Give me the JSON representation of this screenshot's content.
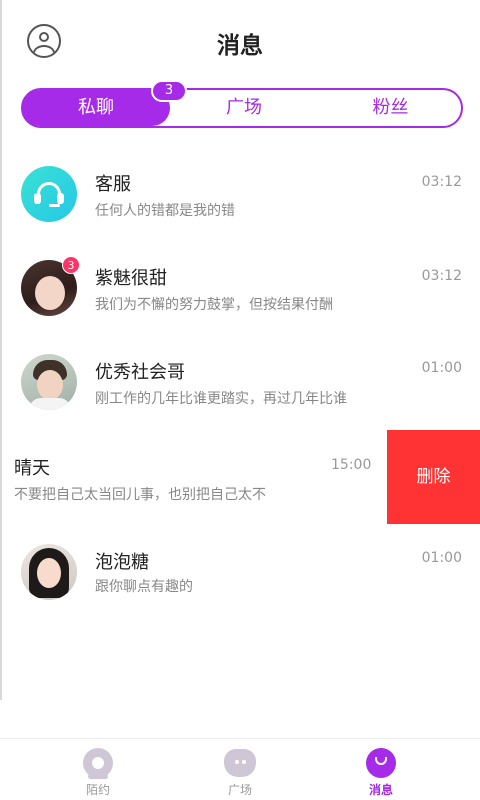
{
  "header": {
    "title": "消息",
    "profile_icon": "user-circle-icon"
  },
  "tabs": [
    {
      "label": "私聊",
      "active": true,
      "badge": "3"
    },
    {
      "label": "广场",
      "active": false
    },
    {
      "label": "粉丝",
      "active": false
    }
  ],
  "conversations": [
    {
      "name": "客服",
      "preview": "任何人的错都是我的错",
      "time": "03:12",
      "avatar": "headset-icon"
    },
    {
      "name": "紫魅很甜",
      "preview": "我们为不懈的努力鼓掌，但按结果付酬",
      "time": "03:12",
      "unread": "3",
      "avatar": "user-photo"
    },
    {
      "name": "优秀社会哥",
      "preview": "刚工作的几年比谁更踏实，再过几年比谁",
      "time": "01:00",
      "avatar": "user-photo"
    },
    {
      "name": "晴天",
      "preview": "不要把自己太当回儿事，也别把自己太不",
      "time": "15:00",
      "action": "删除"
    },
    {
      "name": "泡泡糖",
      "preview": "跟你聊点有趣的",
      "time": "01:00",
      "avatar": "user-photo"
    }
  ],
  "bottom_nav": [
    {
      "label": "陌约",
      "icon": "webcam-icon",
      "active": false
    },
    {
      "label": "广场",
      "icon": "square-icon",
      "active": false
    },
    {
      "label": "消息",
      "icon": "message-icon",
      "active": true
    }
  ],
  "colors": {
    "accent": "#a52be8",
    "delete": "#ff3333",
    "badge": "#ff3366",
    "service": "#30d5dc"
  }
}
